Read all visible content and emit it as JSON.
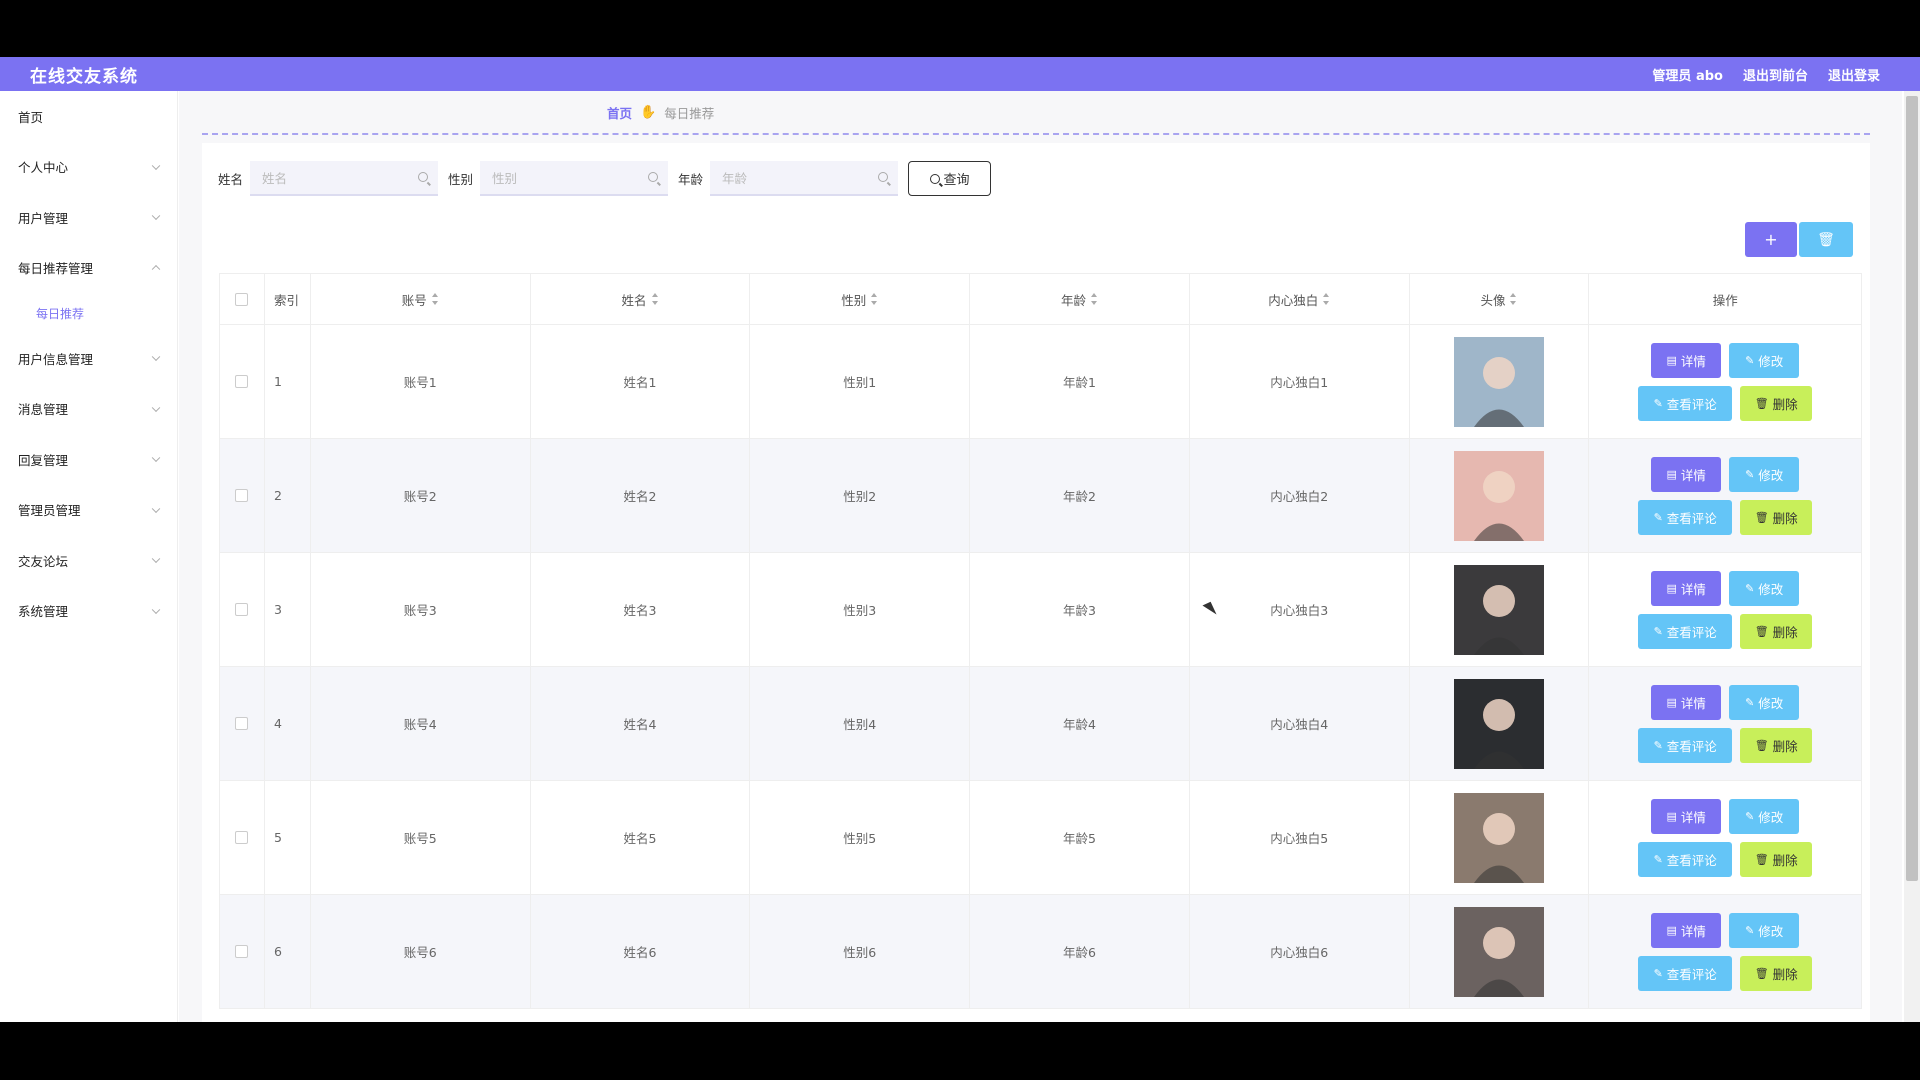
{
  "header": {
    "app_title": "在线交友系统",
    "admin": "管理员 abo",
    "to_front": "退出到前台",
    "logout": "退出登录"
  },
  "sidebar": {
    "items": [
      {
        "label": "首页",
        "chevron": false
      },
      {
        "label": "个人中心",
        "chevron": true
      },
      {
        "label": "用户管理",
        "chevron": true
      },
      {
        "label": "每日推荐管理",
        "chevron": true,
        "expanded": true
      },
      {
        "label": "用户信息管理",
        "chevron": true
      },
      {
        "label": "消息管理",
        "chevron": true
      },
      {
        "label": "回复管理",
        "chevron": true
      },
      {
        "label": "管理员管理",
        "chevron": true
      },
      {
        "label": "交友论坛",
        "chevron": true
      },
      {
        "label": "系统管理",
        "chevron": true
      }
    ],
    "sub_item": "每日推荐"
  },
  "breadcrumb": {
    "home": "首页",
    "current": "每日推荐"
  },
  "search": {
    "name_label": "姓名",
    "name_placeholder": "姓名",
    "gender_label": "性别",
    "gender_placeholder": "性别",
    "age_label": "年龄",
    "age_placeholder": "年龄",
    "query_button": "查询"
  },
  "table": {
    "headers": [
      "索引",
      "账号",
      "姓名",
      "性别",
      "年龄",
      "内心独白",
      "头像",
      "操作"
    ],
    "rows": [
      {
        "index": "1",
        "account": "账号1",
        "name": "姓名1",
        "gender": "性别1",
        "age": "年龄1",
        "monologue": "内心独白1",
        "avatar_color": "#9fb6c9"
      },
      {
        "index": "2",
        "account": "账号2",
        "name": "姓名2",
        "gender": "性别2",
        "age": "年龄2",
        "monologue": "内心独白2",
        "avatar_color": "#e6b8b0"
      },
      {
        "index": "3",
        "account": "账号3",
        "name": "姓名3",
        "gender": "性别3",
        "age": "年龄3",
        "monologue": "内心独白3",
        "avatar_color": "#3b3a3c"
      },
      {
        "index": "4",
        "account": "账号4",
        "name": "姓名4",
        "gender": "性别4",
        "age": "年龄4",
        "monologue": "内心独白4",
        "avatar_color": "#2b2d30"
      },
      {
        "index": "5",
        "account": "账号5",
        "name": "姓名5",
        "gender": "性别5",
        "age": "年龄5",
        "monologue": "内心独白5",
        "avatar_color": "#8a7a6e"
      },
      {
        "index": "6",
        "account": "账号6",
        "name": "姓名6",
        "gender": "性别6",
        "age": "年龄6",
        "monologue": "内心独白6",
        "avatar_color": "#6b6260"
      }
    ],
    "actions": {
      "detail": "详情",
      "edit": "修改",
      "comment": "查看评论",
      "delete": "删除"
    }
  },
  "colors": {
    "accent": "#7b72f2",
    "info": "#64c5f7",
    "warn": "#c8ef5a"
  },
  "icons": {
    "add": "plus-icon",
    "batch_delete": "trash-icon",
    "breadcrumb": "hand-icon"
  }
}
